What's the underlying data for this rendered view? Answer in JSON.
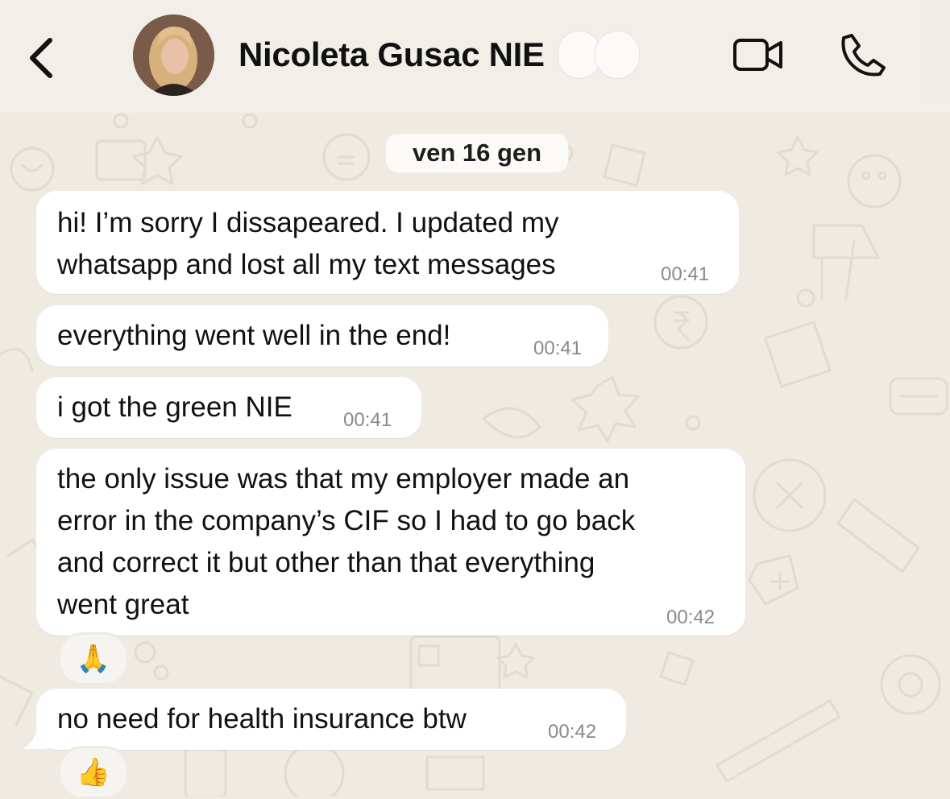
{
  "header": {
    "contact_name": "Nicoleta Gusac NIE",
    "icons": [
      "back-chevron-icon",
      "video-call-icon",
      "phone-icon"
    ]
  },
  "chat": {
    "date_separator": "ven 16 gen",
    "messages": [
      {
        "lines": [
          "hi! I’m sorry I dissapeared. I updated my",
          "whatsapp and lost all my text messages"
        ],
        "time": "00:41"
      },
      {
        "lines": [
          "everything went well in the end!"
        ],
        "time": "00:41"
      },
      {
        "lines": [
          "i got the green NIE"
        ],
        "time": "00:41"
      },
      {
        "lines": [
          "the only issue was that my employer made an",
          "error in the company’s CIF so I had to go back",
          "and correct it but other than that everything",
          "went great"
        ],
        "time": "00:42",
        "reaction": "🙏"
      },
      {
        "lines": [
          "no need for health insurance btw"
        ],
        "time": "00:42",
        "reaction": "👍"
      }
    ]
  },
  "colors": {
    "background": "#efeae2",
    "bubble": "#ffffff",
    "timestamp": "#8a8a8a"
  }
}
